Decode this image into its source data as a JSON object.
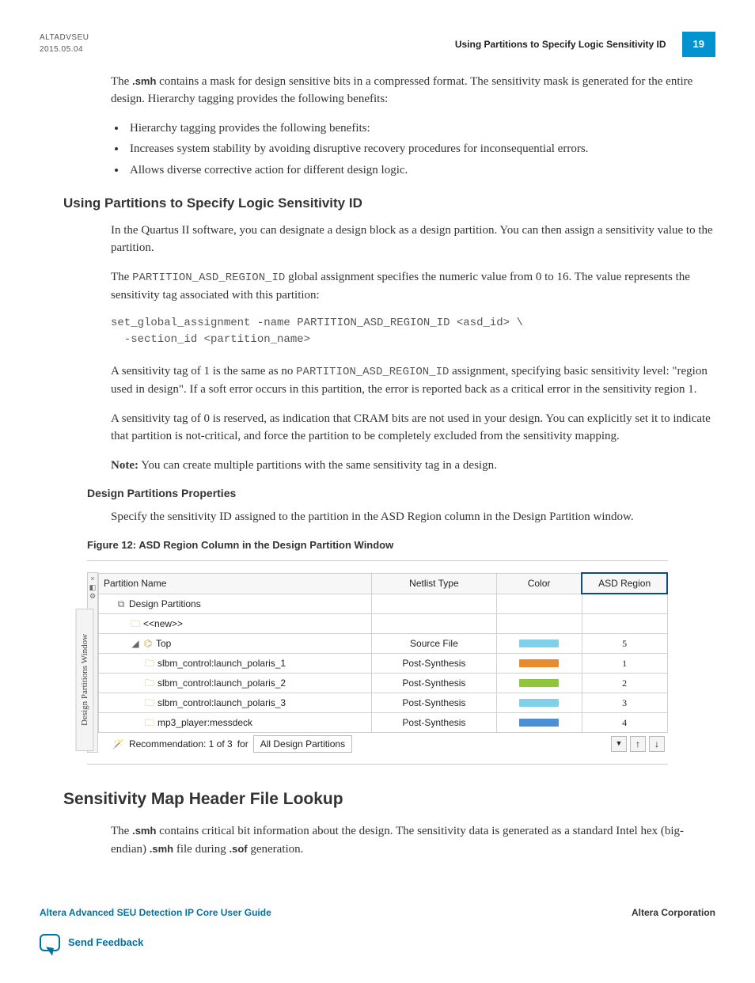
{
  "header": {
    "doc_code": "ALTADVSEU",
    "date": "2015.05.04",
    "section_title": "Using Partitions to Specify Logic Sensitivity ID",
    "page_number": "19"
  },
  "intro": {
    "p1a": "The ",
    "ext1": ".smh",
    "p1b": " contains a mask for design sensitive bits in a compressed format. The sensitivity mask is generated for the entire design. Hierarchy tagging provides the following benefits:",
    "bullets": [
      "Hierarchy tagging provides the following benefits:",
      "Increases system stability by avoiding disruptive recovery procedures for inconsequential errors.",
      "Allows diverse corrective action for different design logic."
    ]
  },
  "section_partitions": {
    "heading": "Using Partitions to Specify Logic Sensitivity ID",
    "p1": "In the Quartus II software, you can designate a design block as a design partition. You can then assign a sensitivity value to the partition.",
    "p2a": "The ",
    "code1": "PARTITION_ASD_REGION_ID",
    "p2b": " global assignment specifies the numeric value from 0 to 16. The value represents the sensitivity tag associated with this partition:",
    "code_block": "set_global_assignment -name PARTITION_ASD_REGION_ID <asd_id> \\\n  -section_id <partition_name>",
    "p3a": "A sensitivity tag of 1 is the same as no ",
    "code2": "PARTITION_ASD_REGION_ID",
    "p3b": " assignment, specifying basic sensitivity level: \"region used in design\". If a soft error occurs in this partition, the error is reported back as a critical error in the sensitivity region 1.",
    "p4": "A sensitivity tag of 0 is reserved, as indication that CRAM bits are not used in your design. You can explicitly set it to indicate that partition is not-critical, and force the partition to be completely excluded from the sensitivity mapping.",
    "note_label": "Note:",
    "note_text": "You can create multiple partitions with the same sensitivity tag in a design."
  },
  "section_props": {
    "heading": "Design Partitions Properties",
    "p1": "Specify the sensitivity ID assigned to the partition in the ASD Region column in the Design Partition window.",
    "figure_caption": "Figure 12: ASD Region Column in the Design Partition Window"
  },
  "panel": {
    "tab_label": "Design Partitions Window",
    "columns": {
      "c1": "Partition Name",
      "c2": "Netlist Type",
      "c3": "Color",
      "c4": "ASD Region"
    },
    "rows": [
      {
        "indent": 1,
        "icon": "partitions-icon",
        "name": "Design Partitions",
        "netlist": "",
        "color": "",
        "asd": ""
      },
      {
        "indent": 2,
        "icon": "folder-icon",
        "name": "<<new>>",
        "netlist": "",
        "color": "",
        "asd": ""
      },
      {
        "indent": 2,
        "icon": "hierarchy-icon",
        "name": "Top",
        "prefix": "◢",
        "netlist": "Source File",
        "color": "#7fd0e8",
        "asd": "5"
      },
      {
        "indent": 3,
        "icon": "folder-icon",
        "name": "slbm_control:launch_polaris_1",
        "netlist": "Post-Synthesis",
        "color": "#e88b2e",
        "asd": "1"
      },
      {
        "indent": 3,
        "icon": "folder-icon",
        "name": "slbm_control:launch_polaris_2",
        "netlist": "Post-Synthesis",
        "color": "#8fc63d",
        "asd": "2"
      },
      {
        "indent": 3,
        "icon": "folder-icon",
        "name": "slbm_control:launch_polaris_3",
        "netlist": "Post-Synthesis",
        "color": "#7fd0e8",
        "asd": "3"
      },
      {
        "indent": 3,
        "icon": "folder-icon",
        "name": "mp3_player:messdeck",
        "netlist": "Post-Synthesis",
        "color": "#4a90d9",
        "asd": "4"
      }
    ],
    "footer": {
      "rec_label": "Recommendation: 1 of 3",
      "for_label": "for",
      "combo_value": "All Design Partitions"
    }
  },
  "section_lookup": {
    "heading": "Sensitivity Map Header File Lookup",
    "p1a": "The ",
    "ext1": ".smh",
    "p1b": " contains critical bit information about the design. The sensitivity data is generated as a standard Intel hex (big-endian) ",
    "ext2": ".smh",
    "p1c": " file during ",
    "ext3": ".sof",
    "p1d": " generation."
  },
  "footer": {
    "left": "Altera Advanced SEU Detection IP Core User Guide",
    "right": "Altera Corporation",
    "feedback": "Send Feedback"
  }
}
